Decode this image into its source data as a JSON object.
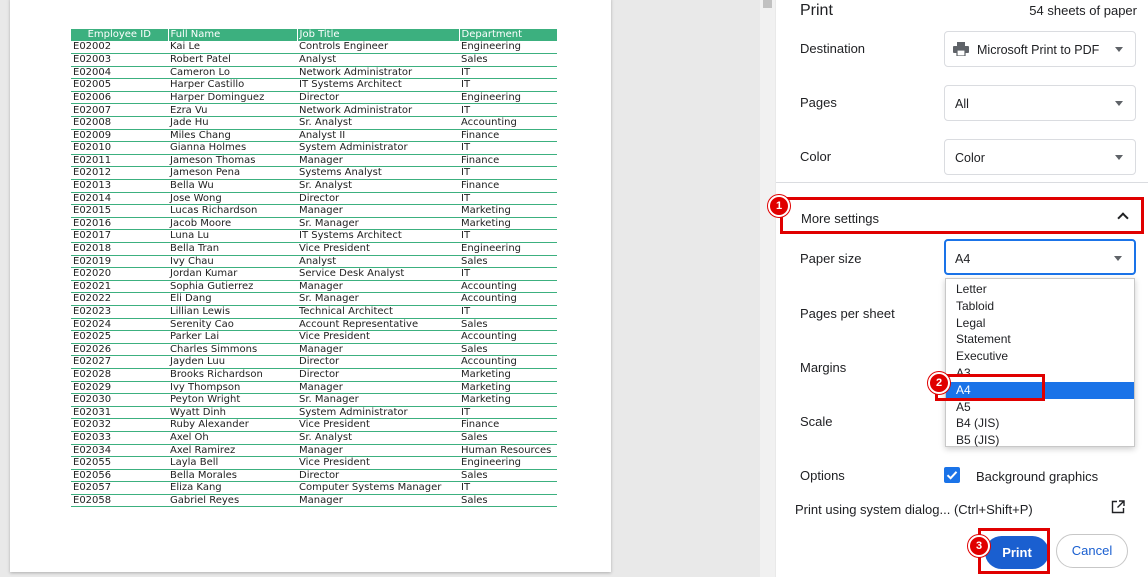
{
  "table": {
    "headers": [
      "Employee ID",
      "Full Name",
      "Job Title",
      "Department"
    ],
    "rows": [
      [
        "E02002",
        "Kai Le",
        "Controls Engineer",
        "Engineering"
      ],
      [
        "E02003",
        "Robert Patel",
        "Analyst",
        "Sales"
      ],
      [
        "E02004",
        "Cameron Lo",
        "Network Administrator",
        "IT"
      ],
      [
        "E02005",
        "Harper Castillo",
        "IT Systems Architect",
        "IT"
      ],
      [
        "E02006",
        "Harper Dominguez",
        "Director",
        "Engineering"
      ],
      [
        "E02007",
        "Ezra Vu",
        "Network Administrator",
        "IT"
      ],
      [
        "E02008",
        "Jade Hu",
        "Sr. Analyst",
        "Accounting"
      ],
      [
        "E02009",
        "Miles Chang",
        "Analyst II",
        "Finance"
      ],
      [
        "E02010",
        "Gianna Holmes",
        "System Administrator",
        "IT"
      ],
      [
        "E02011",
        "Jameson Thomas",
        "Manager",
        "Finance"
      ],
      [
        "E02012",
        "Jameson Pena",
        "Systems Analyst",
        "IT"
      ],
      [
        "E02013",
        "Bella Wu",
        "Sr. Analyst",
        "Finance"
      ],
      [
        "E02014",
        "Jose Wong",
        "Director",
        "IT"
      ],
      [
        "E02015",
        "Lucas Richardson",
        "Manager",
        "Marketing"
      ],
      [
        "E02016",
        "Jacob Moore",
        "Sr. Manager",
        "Marketing"
      ],
      [
        "E02017",
        "Luna Lu",
        "IT Systems Architect",
        "IT"
      ],
      [
        "E02018",
        "Bella Tran",
        "Vice President",
        "Engineering"
      ],
      [
        "E02019",
        "Ivy Chau",
        "Analyst",
        "Sales"
      ],
      [
        "E02020",
        "Jordan Kumar",
        "Service Desk Analyst",
        "IT"
      ],
      [
        "E02021",
        "Sophia Gutierrez",
        "Manager",
        "Accounting"
      ],
      [
        "E02022",
        "Eli Dang",
        "Sr. Manager",
        "Accounting"
      ],
      [
        "E02023",
        "Lillian Lewis",
        "Technical Architect",
        "IT"
      ],
      [
        "E02024",
        "Serenity Cao",
        "Account Representative",
        "Sales"
      ],
      [
        "E02025",
        "Parker Lai",
        "Vice President",
        "Accounting"
      ],
      [
        "E02026",
        "Charles Simmons",
        "Manager",
        "Sales"
      ],
      [
        "E02027",
        "Jayden Luu",
        "Director",
        "Accounting"
      ],
      [
        "E02028",
        "Brooks Richardson",
        "Director",
        "Marketing"
      ],
      [
        "E02029",
        "Ivy Thompson",
        "Manager",
        "Marketing"
      ],
      [
        "E02030",
        "Peyton Wright",
        "Sr. Manager",
        "Marketing"
      ],
      [
        "E02031",
        "Wyatt Dinh",
        "System Administrator",
        "IT"
      ],
      [
        "E02032",
        "Ruby Alexander",
        "Vice President",
        "Finance"
      ],
      [
        "E02033",
        "Axel Oh",
        "Sr. Analyst",
        "Sales"
      ],
      [
        "E02034",
        "Axel Ramirez",
        "Manager",
        "Human Resources"
      ],
      [
        "E02055",
        "Layla Bell",
        "Vice President",
        "Engineering"
      ],
      [
        "E02056",
        "Bella Morales",
        "Director",
        "Sales"
      ],
      [
        "E02057",
        "Eliza Kang",
        "Computer Systems Manager",
        "IT"
      ],
      [
        "E02058",
        "Gabriel Reyes",
        "Manager",
        "Sales"
      ]
    ]
  },
  "panel": {
    "title": "Print",
    "sheets": "54 sheets of paper",
    "destination_label": "Destination",
    "destination_value": "Microsoft Print to PDF",
    "pages_label": "Pages",
    "pages_value": "All",
    "color_label": "Color",
    "color_value": "Color",
    "more_settings_label": "More settings",
    "paper_size_label": "Paper size",
    "paper_size_value": "A4",
    "pages_per_sheet_label": "Pages per sheet",
    "margins_label": "Margins",
    "scale_label": "Scale",
    "options_label": "Options",
    "background_graphics_label": "Background graphics",
    "system_dialog_label": "Print using system dialog... (Ctrl+Shift+P)",
    "print_label": "Print",
    "cancel_label": "Cancel"
  },
  "paper_options": [
    "Letter",
    "Tabloid",
    "Legal",
    "Statement",
    "Executive",
    "A3",
    "A4",
    "A5",
    "B4 (JIS)",
    "B5 (JIS)"
  ],
  "selected_paper_option": "A4",
  "badges": [
    "1",
    "2",
    "3"
  ],
  "colors": {
    "accent": "#1a73e8",
    "highlight": "#e00000",
    "table_header": "#3cb07f"
  },
  "icons": {
    "printer": "printer-icon",
    "open_external": "open-in-new-icon",
    "chevron_up": "chevron-up-icon",
    "caret": "caret-down-icon",
    "check": "check-icon"
  }
}
